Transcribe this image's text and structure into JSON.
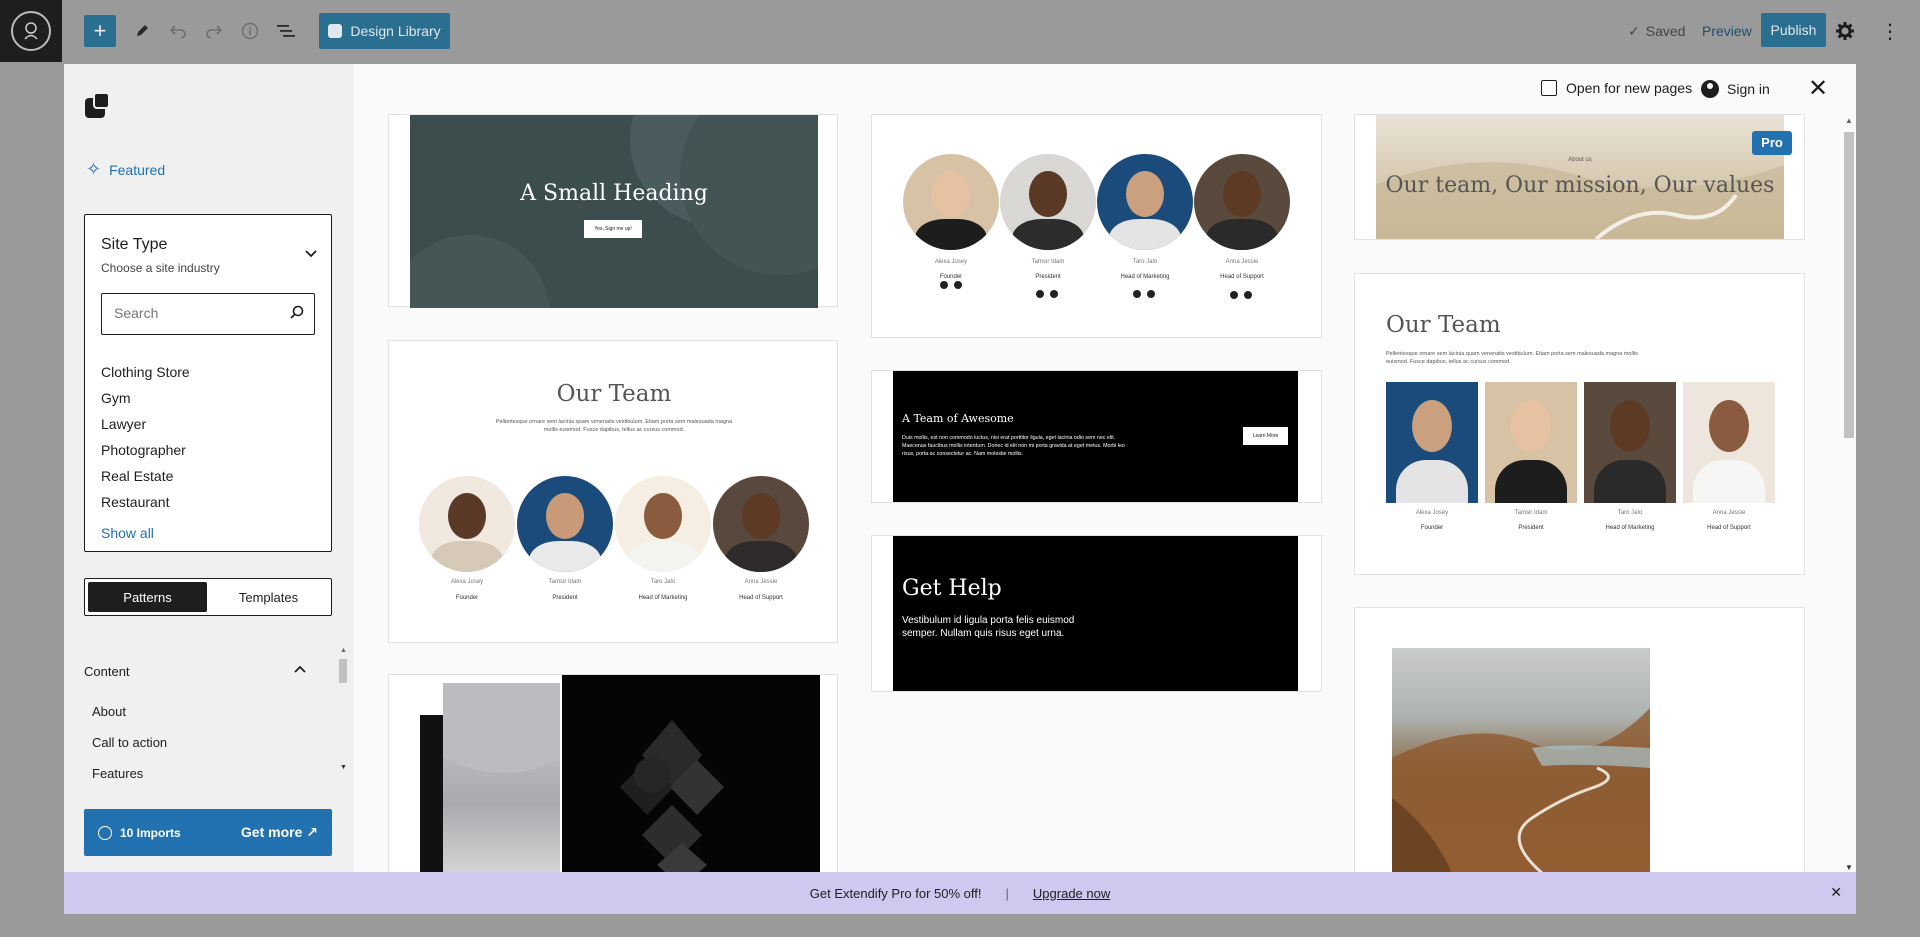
{
  "topbar": {
    "design_library": "Design Library",
    "saved": "Saved",
    "preview": "Preview",
    "publish": "Publish"
  },
  "sidebar": {
    "featured": "Featured",
    "site_type": {
      "title": "Site Type",
      "subtitle": "Choose a site industry",
      "search_placeholder": "Search",
      "items": [
        "Clothing Store",
        "Gym",
        "Lawyer",
        "Photographer",
        "Real Estate",
        "Restaurant"
      ],
      "show_all": "Show all"
    },
    "tabs": [
      "Patterns",
      "Templates"
    ],
    "content": {
      "header": "Content",
      "items": [
        "About",
        "Call to action",
        "Features"
      ]
    },
    "imports": {
      "count": "10 Imports",
      "get_more": "Get more"
    }
  },
  "header": {
    "open_new_pages": "Open for new pages",
    "sign_in": "Sign in"
  },
  "patterns": {
    "small_heading": {
      "title": "A Small Heading",
      "button": "Yes, Sign me up!"
    },
    "team_circles_top": {
      "names": [
        "Alexa Josey",
        "Tamsir Idam",
        "Taro Jalo",
        "Anna Jessie"
      ],
      "roles": [
        "Founder",
        "President",
        "Head of Marketing",
        "Head of Support"
      ]
    },
    "team_mission": {
      "kicker": "About us",
      "title": "Our team, Our mission, Our values",
      "badge": "Pro"
    },
    "our_team_circles": {
      "title": "Our Team",
      "text": "Pellentesque ornare sem lacinia quam venenatis vestibulum. Etiam porta sem malesuada magna mollis euismod. Fusce dapibus, tellus ac cursus commod.",
      "names": [
        "Alexa Josey",
        "Tamsir Idam",
        "Taro Jalo",
        "Anna Jessie"
      ],
      "roles": [
        "Founder",
        "President",
        "Head of Marketing",
        "Head of Support"
      ]
    },
    "awesome_team": {
      "title": "A Team of Awesome",
      "text": "Duis mollis, est non commodo luctus, nisi erat porttitor ligula, eget lacinia odio sem nec elit. Maecenas faucibus mollis interdum. Donec id elit non mi porta gravida at eget metus. Morbi leo risus, porta ac consectetur ac. Nam molestie mollis.",
      "button": "Learn More"
    },
    "get_help": {
      "title": "Get Help",
      "text": "Vestibulum id ligula porta felis euismod semper. Nullam quis risus eget urna."
    },
    "our_team_photos": {
      "title": "Our Team",
      "text": "Pellentesque ornare sem lacinia quam venenatis vestibulum. Etiam porta sem malesuada magna mollis euismod. Fusce dapibus, tellus ac cursus commod.",
      "names": [
        "Alexa Josey",
        "Tamsir Idam",
        "Taro Jalo",
        "Anna Jessie"
      ],
      "roles": [
        "Founder",
        "President",
        "Head of Marketing",
        "Head of Support"
      ]
    }
  },
  "promo": {
    "text": "Get Extendify Pro for 50% off!",
    "separator": "|",
    "link": "Upgrade now"
  },
  "colors": {
    "accent": "#2271b1",
    "promo_bg": "#cfc8ef",
    "dark": "#1e1e1e"
  }
}
